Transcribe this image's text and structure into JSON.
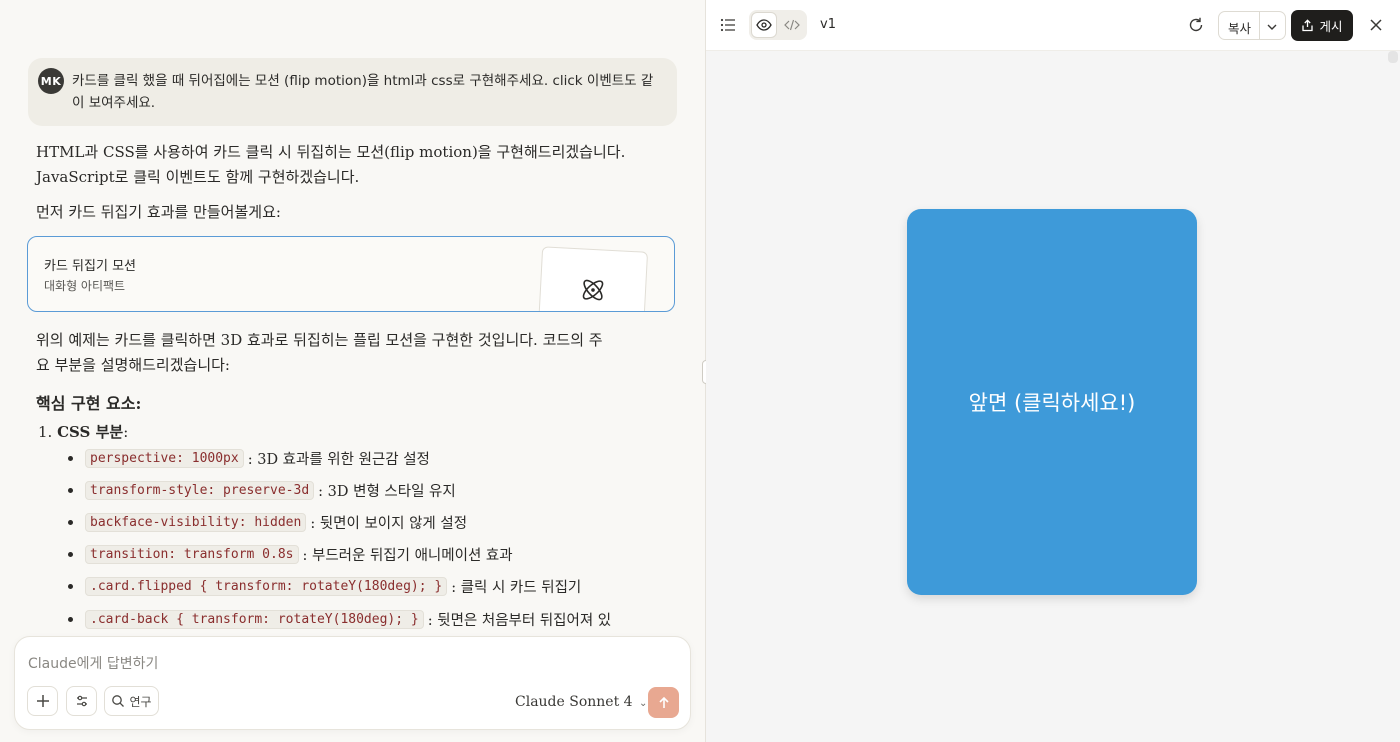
{
  "chat": {
    "user_message": {
      "avatar_initials": "MK",
      "text": "카드를 클릭 했을 때 뒤어집에는 모션 (flip motion)을 html과 css로 구현해주세요. click 이벤트도 같이 보여주세요."
    },
    "response_intro_line1": "HTML과 CSS를 사용하여 카드 클릭 시 뒤집히는 모션(flip motion)을 구현해드리겠습니다.",
    "response_intro_line2": "JavaScript로 클릭 이벤트도 함께 구현하겠습니다.",
    "response_lead": "먼저 카드 뒤집기 효과를 만들어볼게요:",
    "artifact": {
      "title": "카드 뒤집기 모션",
      "subtitle": "대화형 아티팩트",
      "icon": "atom-react-icon"
    },
    "explain_line1": "위의 예제는 카드를 클릭하면 3D 효과로 뒤집히는 플립 모션을 구현한 것입니다. 코드의 주",
    "explain_line2": "요 부분을 설명해드리겠습니다:",
    "section_heading": "핵심 구현 요소:",
    "list_item_1": {
      "number": "1.",
      "label": "CSS 부분",
      "suffix": ":"
    },
    "bullets": [
      {
        "code": "perspective: 1000px",
        "desc": ": 3D 효과를 위한 원근감 설정"
      },
      {
        "code": "transform-style: preserve-3d",
        "desc": ": 3D 변형 스타일 유지"
      },
      {
        "code": "backface-visibility: hidden",
        "desc": ": 뒷면이 보이지 않게 설정"
      },
      {
        "code": "transition: transform 0.8s",
        "desc": ": 부드러운 뒤집기 애니메이션 효과"
      },
      {
        "code": ".card.flipped { transform: rotateY(180deg); }",
        "desc": ": 클릭 시 카드 뒤집기"
      },
      {
        "code": ".card-back { transform: rotateY(180deg); }",
        "desc": ": 뒷면은 처음부터 뒤집어져 있"
      }
    ],
    "input": {
      "placeholder": "Claude에게 답변하기",
      "research_label": "연구",
      "model_label": "Claude Sonnet 4"
    }
  },
  "preview": {
    "version": "v1",
    "copy_label": "복사",
    "publish_label": "게시",
    "card_front_text": "앞면 (클릭하세요!)",
    "card_color": "#3e9ad9"
  },
  "colors": {
    "accent_send": "#e8a891",
    "artifact_border": "#5b9bd6",
    "code_text": "#8a2e2e"
  }
}
